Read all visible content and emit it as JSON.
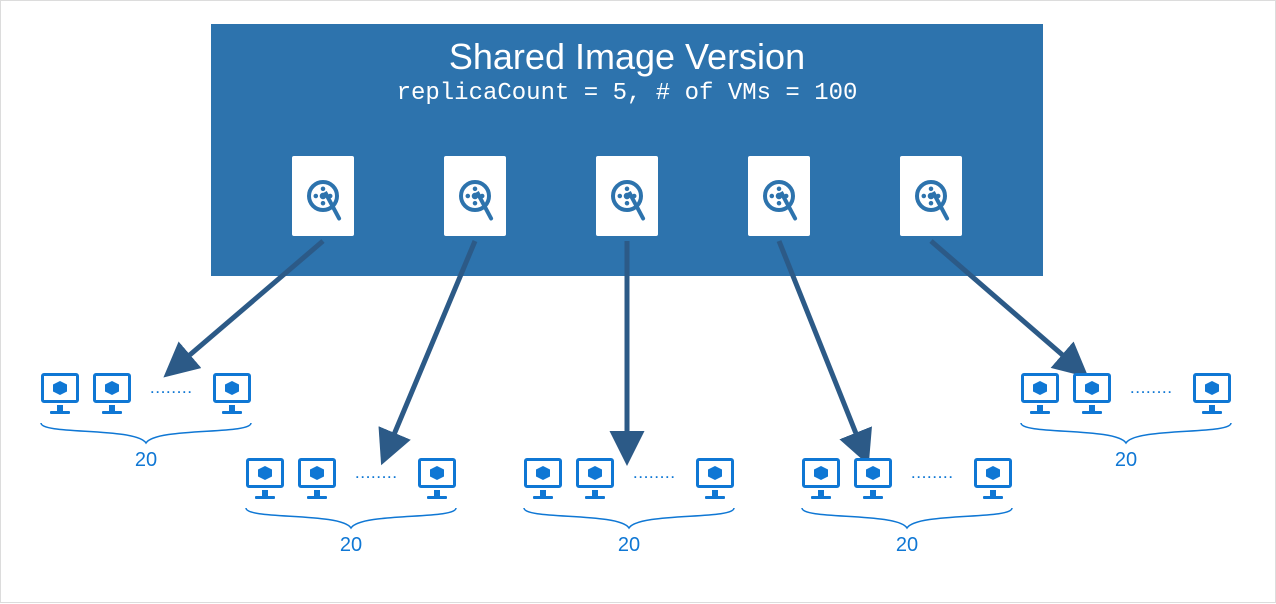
{
  "header": {
    "title": "Shared Image Version",
    "subtitle": "replicaCount = 5, # of VMs = 100"
  },
  "replicas": {
    "count": 5
  },
  "groups": [
    {
      "label": "20",
      "ellipsis": "........"
    },
    {
      "label": "20",
      "ellipsis": "........"
    },
    {
      "label": "20",
      "ellipsis": "........"
    },
    {
      "label": "20",
      "ellipsis": "........"
    },
    {
      "label": "20",
      "ellipsis": "........"
    }
  ],
  "chart_data": {
    "type": "diagram",
    "title": "Shared Image Version replica fan-out",
    "replicaCount": 5,
    "totalVMs": 100,
    "vmsPerReplica": [
      20,
      20,
      20,
      20,
      20
    ]
  }
}
